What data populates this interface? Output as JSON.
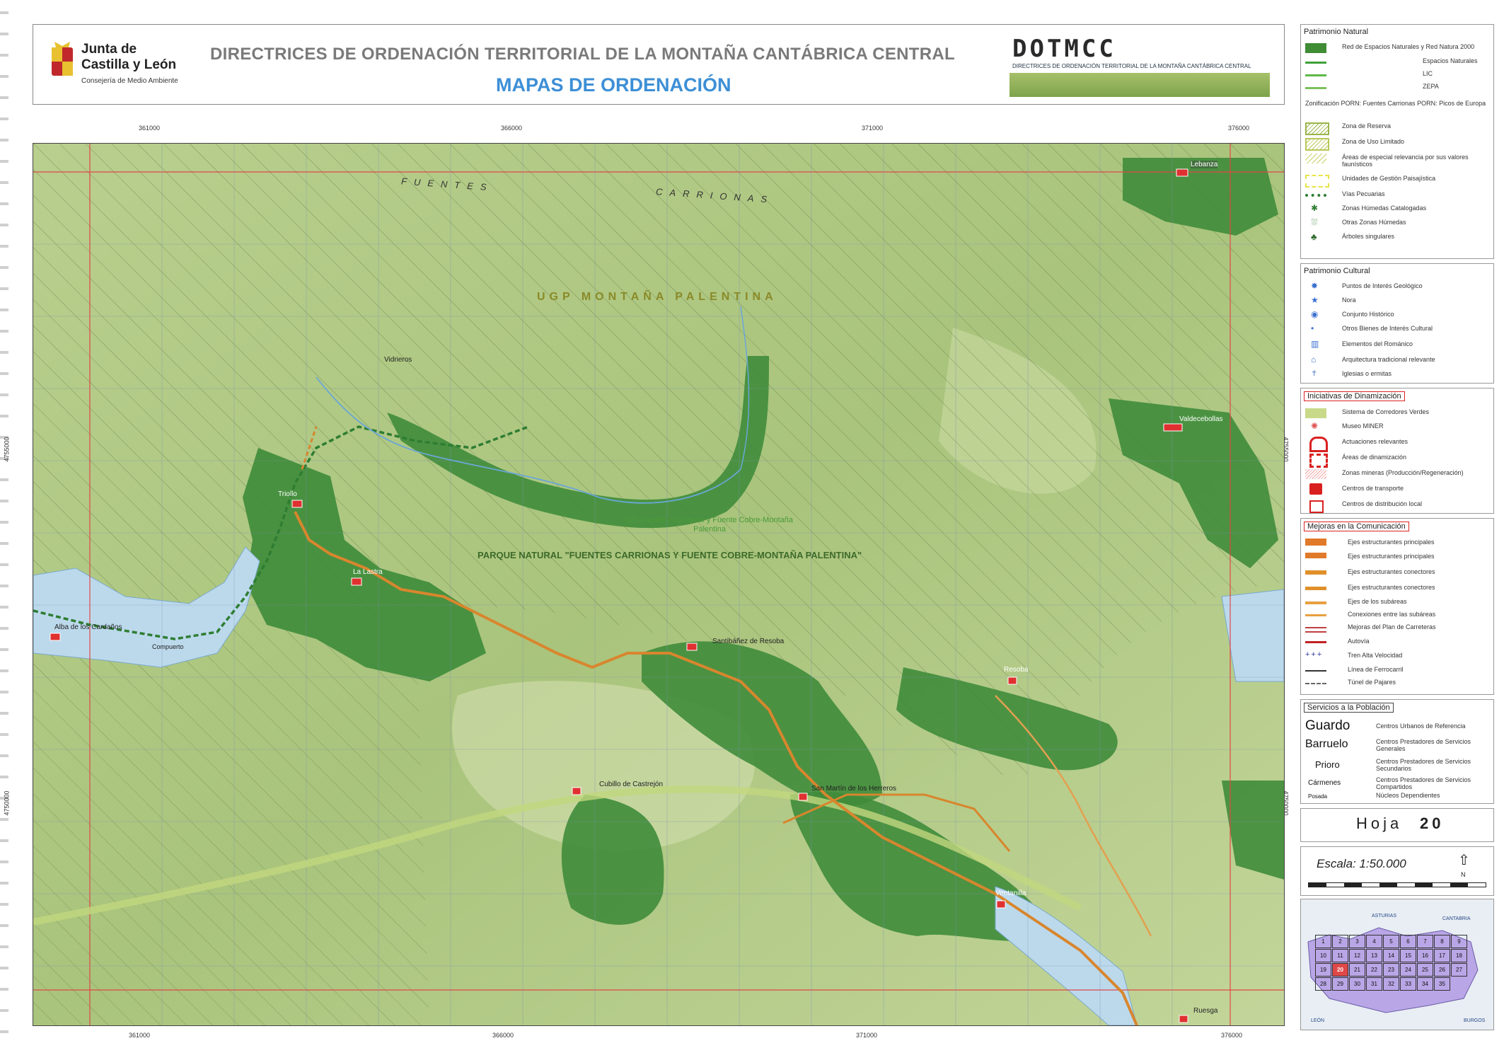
{
  "header": {
    "org_line1": "Junta de",
    "org_line2": "Castilla y León",
    "org_sub": "Consejería de Medio Ambiente",
    "title": "DIRECTRICES DE ORDENACIÓN TERRITORIAL DE LA MONTAÑA CANTÁBRICA CENTRAL",
    "subtitle": "MAPAS DE ORDENACIÓN",
    "dot_logo": "DOTMCC",
    "dot_sub": "DIRECTRICES DE ORDENACIÓN TERRITORIAL DE LA MONTAÑA CANTÁBRICA CENTRAL"
  },
  "coords": {
    "top": [
      "361000",
      "366000",
      "371000",
      "376000"
    ],
    "bottom": [
      "361000",
      "366000",
      "371000",
      "376000"
    ],
    "left": [
      "4755000",
      "4750000"
    ],
    "right": [
      "4755000",
      "4750000"
    ]
  },
  "map": {
    "region_labels": [
      "FUENTES",
      "CARRIONAS",
      "UGP MONTAÑA PALENTINA"
    ],
    "park_label": "PARQUE NATURAL \"FUENTES CARRIONAS Y FUENTE COBRE-MONTAÑA PALENTINA\"",
    "lic_label": "LIC Fuentes Carrionas y Fuente Cobre-Montaña Palentina",
    "towns": [
      {
        "name": "Lebanza"
      },
      {
        "name": "Vidrieros"
      },
      {
        "name": "Triollo"
      },
      {
        "name": "Valdecebollas"
      },
      {
        "name": "La Lastra"
      },
      {
        "name": "Alba de los Cardaños"
      },
      {
        "name": "Santibáñez de Resoba"
      },
      {
        "name": "Resoba"
      },
      {
        "name": "Cubillo de Castrejón"
      },
      {
        "name": "San Martín de los Herreros"
      },
      {
        "name": "Ventanilla"
      },
      {
        "name": "Ruesga"
      },
      {
        "name": "Compuerto"
      }
    ]
  },
  "legend": {
    "natural": {
      "title": "Patrimonio Natural",
      "rows": [
        {
          "label": "Red de Espacios Naturales y Red Natura 2000",
          "color": "#3f8c35"
        },
        {
          "label": "Espacios Naturales",
          "color": "#3fa03a"
        },
        {
          "label": "LIC",
          "color": "#5fb84a"
        },
        {
          "label": "ZEPA",
          "color": "#7cc05a"
        },
        {
          "label": "Zonificación  PORN: Fuentes Carrionas  PORN: Picos de Europa",
          "color": "#888888"
        },
        {
          "label": "Zona de Reserva",
          "color": "#9ab54a"
        },
        {
          "label": "Zona de Uso Limitado",
          "color": "#b8c75a"
        },
        {
          "label": "Áreas de especial relevancia por sus valores faunísticos",
          "color": "#c9d26a"
        },
        {
          "label": "Unidades de Gestión Paisajística",
          "color": "#e8e34a"
        },
        {
          "label": "Vías Pecuarias",
          "color": "#2e7d32"
        },
        {
          "label": "Zonas Húmedas Catalogadas",
          "color": "#2e7d32"
        },
        {
          "label": "Otras Zonas Húmedas",
          "color": "#4a8a4a"
        },
        {
          "label": "Árboles singulares",
          "color": "#2e6b2e"
        }
      ]
    },
    "cultural": {
      "title": "Patrimonio Cultural",
      "rows": [
        {
          "label": "Puntos de Interés Geológico",
          "color": "#3a6fd0"
        },
        {
          "label": "Nora",
          "color": "#3a6fd0"
        },
        {
          "label": "Conjunto Histórico",
          "color": "#3a6fd0"
        },
        {
          "label": "Otros Bienes de Interés Cultural",
          "color": "#3a6fd0"
        },
        {
          "label": "Elementos del Románico",
          "color": "#3a6fd0"
        },
        {
          "label": "Arquitectura tradicional relevante",
          "color": "#3a6fd0"
        },
        {
          "label": "Iglesias o ermitas",
          "color": "#7a9ad0"
        }
      ]
    },
    "dinamizacion": {
      "title": "Iniciativas de Dinamización",
      "rows": [
        {
          "label": "Sistema de Corredores Verdes",
          "color": "#c9d98a"
        },
        {
          "label": "Museo MINER",
          "color": "#e05050"
        },
        {
          "label": "Actuaciones relevantes",
          "color": "#d92020"
        },
        {
          "label": "Áreas de dinamización",
          "color": "#d92020"
        },
        {
          "label": "Zonas mineras (Producción/Regeneración)",
          "color": "#f0a0a0"
        },
        {
          "label": "Centros de transporte",
          "color": "#d92020"
        },
        {
          "label": "Centros de distribución local",
          "color": "#d92020"
        }
      ]
    },
    "comunicacion": {
      "title": "Mejoras en la Comunicación",
      "rows": [
        {
          "label": "Ejes estructurantes principales",
          "color": "#e07a2a"
        },
        {
          "label": "Ejes estructurantes principales",
          "color": "#e07a2a"
        },
        {
          "label": "Ejes estructurantes conectores",
          "color": "#e0902a"
        },
        {
          "label": "Ejes estructurantes conectores",
          "color": "#e0902a"
        },
        {
          "label": "Ejes de los subáreas",
          "color": "#e8a040"
        },
        {
          "label": "Conexiones entre las subáreas",
          "color": "#e8a040"
        },
        {
          "label": "Mejoras del Plan de Carreteras",
          "color": "#c04040"
        },
        {
          "label": "Autovía",
          "color": "#c02020"
        },
        {
          "label": "Tren Alta Velocidad",
          "color": "#2a3a9a"
        },
        {
          "label": "Línea de Ferrocarril",
          "color": "#333333"
        },
        {
          "label": "Túnel de Pajares",
          "color": "#666666"
        }
      ]
    },
    "servicios": {
      "title": "Servicios a la Población",
      "rows": [
        {
          "name": "Guardo",
          "label": "Centros Urbanos de Referencia"
        },
        {
          "name": "Barruelo",
          "label": "Centros Prestadores de Servicios Generales"
        },
        {
          "name": "Prioro",
          "label": "Centros Prestadores de Servicios Secundarios"
        },
        {
          "name": "Cármenes",
          "label": "Centros Prestadores de Servicios Compartidos"
        },
        {
          "name": "Posada",
          "label": "Núcleos Dependientes"
        }
      ]
    },
    "hoja_label": "Hoja",
    "hoja_number": "20",
    "escala_label": "Escala: 1:50.000",
    "north": "N",
    "index_labels": [
      "ASTURIAS",
      "CANTABRIA",
      "LEÓN",
      "BURGOS"
    ],
    "index_sheets": [
      "1",
      "2",
      "3",
      "4",
      "5",
      "6",
      "7",
      "8",
      "9",
      "10",
      "11",
      "12",
      "13",
      "14",
      "15",
      "16",
      "17",
      "18",
      "19",
      "20",
      "21",
      "22",
      "23",
      "24",
      "25",
      "26",
      "27",
      "28",
      "29",
      "30",
      "31",
      "32",
      "33",
      "34",
      "35"
    ]
  }
}
